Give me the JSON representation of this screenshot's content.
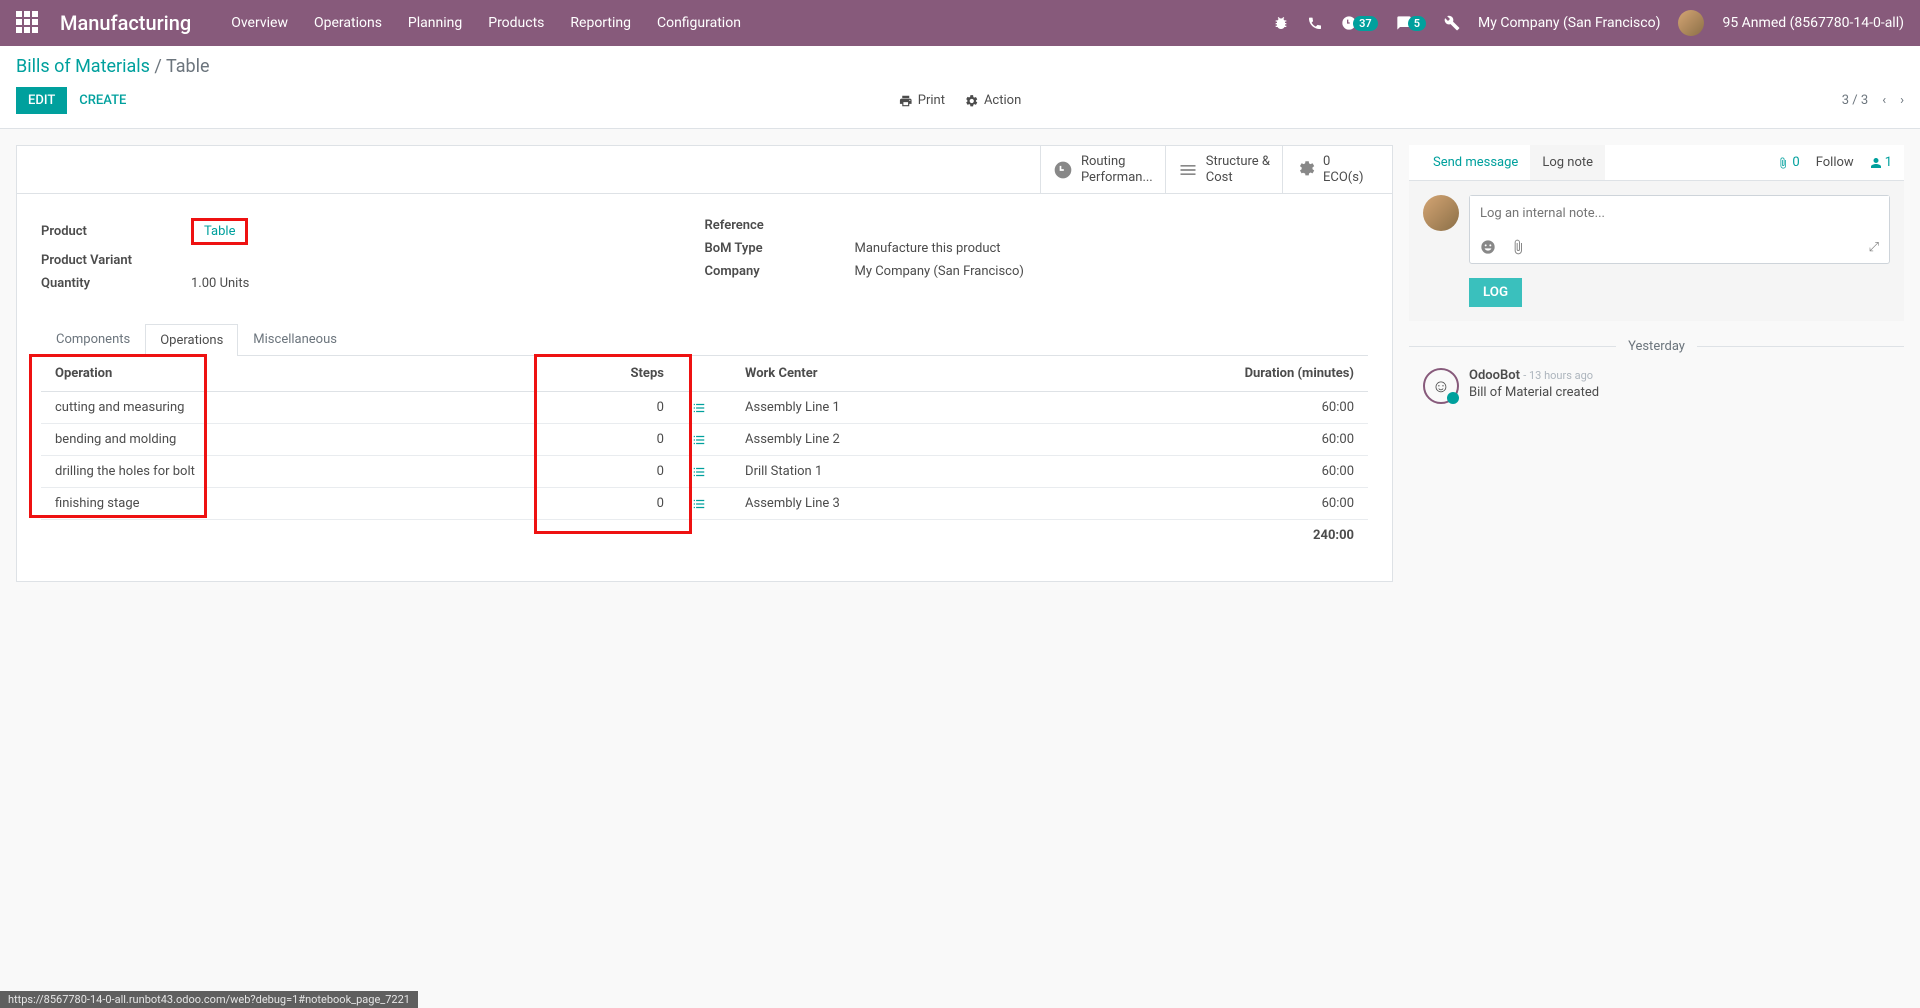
{
  "nav": {
    "brand": "Manufacturing",
    "menu": [
      "Overview",
      "Operations",
      "Planning",
      "Products",
      "Reporting",
      "Configuration"
    ],
    "clock_badge": "37",
    "chat_badge": "5",
    "company": "My Company (San Francisco)",
    "user": "95 Anmed (8567780-14-0-all)"
  },
  "breadcrumb": {
    "root": "Bills of Materials",
    "sep": " / ",
    "current": "Table"
  },
  "buttons": {
    "edit": "EDIT",
    "create": "CREATE",
    "print": "Print",
    "action": "Action"
  },
  "pager": {
    "text": "3 / 3"
  },
  "stats": {
    "routing_l1": "Routing",
    "routing_l2": "Performan...",
    "struct_l1": "Structure &",
    "struct_l2": "Cost",
    "eco_num": "0",
    "eco_label": "ECO(s)"
  },
  "fields": {
    "product_label": "Product",
    "product_value": "Table",
    "variant_label": "Product Variant",
    "variant_value": "",
    "qty_label": "Quantity",
    "qty_value": "1.00 Units",
    "ref_label": "Reference",
    "ref_value": "",
    "bom_label": "BoM Type",
    "bom_value": "Manufacture this product",
    "company_label": "Company",
    "company_value": "My Company (San Francisco)"
  },
  "tabs": [
    "Components",
    "Operations",
    "Miscellaneous"
  ],
  "table": {
    "headers": {
      "op": "Operation",
      "steps": "Steps",
      "wc": "Work Center",
      "dur": "Duration (minutes)"
    },
    "rows": [
      {
        "op": "cutting and measuring",
        "steps": "0",
        "wc": "Assembly Line 1",
        "dur": "60:00"
      },
      {
        "op": "bending and molding",
        "steps": "0",
        "wc": "Assembly Line 2",
        "dur": "60:00"
      },
      {
        "op": "drilling the holes for bolt",
        "steps": "0",
        "wc": "Drill Station 1",
        "dur": "60:00"
      },
      {
        "op": "finishing stage",
        "steps": "0",
        "wc": "Assembly Line 3",
        "dur": "60:00"
      }
    ],
    "total": "240:00"
  },
  "chatter": {
    "send": "Send message",
    "lognote": "Log note",
    "attach_count": "0",
    "follow": "Follow",
    "follower_count": "1",
    "placeholder": "Log an internal note...",
    "log_btn": "LOG",
    "separator": "Yesterday",
    "msg_author": "OdooBot",
    "msg_time": "- 13 hours ago",
    "msg_body": "Bill of Material created"
  },
  "statusbar": "https://8567780-14-0-all.runbot43.odoo.com/web?debug=1#notebook_page_7221"
}
